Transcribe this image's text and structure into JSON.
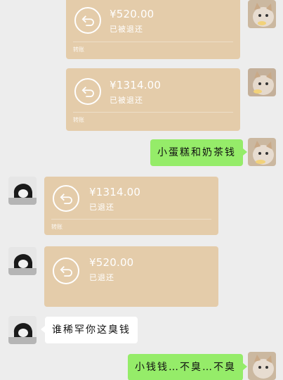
{
  "messages": [
    {
      "side": "right",
      "type": "transfer",
      "amount": "¥520.00",
      "status": "已被退还",
      "footer": "转账"
    },
    {
      "side": "right",
      "type": "transfer",
      "amount": "¥1314.00",
      "status": "已被退还",
      "footer": "转账"
    },
    {
      "side": "right",
      "type": "text",
      "text": "小蛋糕和奶茶钱"
    },
    {
      "side": "left",
      "type": "transfer",
      "amount": "¥1314.00",
      "status": "已退还",
      "footer": "转账"
    },
    {
      "side": "left",
      "type": "transfer",
      "amount": "¥520.00",
      "status": "已退还",
      "footer": ""
    },
    {
      "side": "left",
      "type": "text",
      "text": "谁稀罕你这臭钱"
    },
    {
      "side": "right",
      "type": "text",
      "text": "小钱钱…不臭…不臭"
    }
  ],
  "colors": {
    "background": "#ededed",
    "transfer_card": "#e4ccaa",
    "sent_bubble": "#95ec69",
    "received_bubble": "#ffffff"
  },
  "icons": {
    "transfer_returned": "return-arrow-icon",
    "self_avatar": "cat-avatar",
    "other_avatar": "person-avatar"
  }
}
